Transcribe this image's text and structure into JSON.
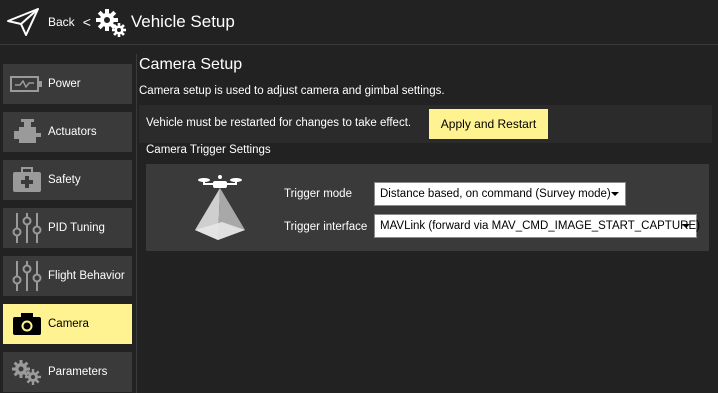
{
  "header": {
    "back_label": "Back",
    "separator": "<",
    "title": "Vehicle Setup",
    "back_icon": "paper-plane-icon",
    "title_icon": "gears-icon"
  },
  "sidebar": {
    "items": [
      {
        "label": "Power",
        "icon": "battery-icon",
        "active": false
      },
      {
        "label": "Actuators",
        "icon": "motor-icon",
        "active": false
      },
      {
        "label": "Safety",
        "icon": "first-aid-kit-icon",
        "active": false
      },
      {
        "label": "PID Tuning",
        "icon": "sliders-icon",
        "active": false
      },
      {
        "label": "Flight Behavior",
        "icon": "sliders-icon",
        "active": false
      },
      {
        "label": "Camera",
        "icon": "camera-icon",
        "active": true
      },
      {
        "label": "Parameters",
        "icon": "gears-icon",
        "active": false
      }
    ]
  },
  "main": {
    "title": "Camera Setup",
    "description": "Camera setup is used to adjust camera and gimbal settings.",
    "restart_notice": "Vehicle must be restarted for changes to take effect.",
    "apply_button": "Apply and Restart",
    "trigger_section": {
      "title": "Camera Trigger Settings",
      "icon": "drone-camera-trigger-icon",
      "trigger_mode_label": "Trigger mode",
      "trigger_mode_value": "Distance based, on command (Survey mode)",
      "trigger_interface_label": "Trigger interface",
      "trigger_interface_value": "MAVLink (forward via MAV_CMD_IMAGE_START_CAPTURE)"
    }
  },
  "colors": {
    "background": "#222222",
    "sidebar_item": "#3a3a3a",
    "accent": "#fff291",
    "panel": "#3a3a3a",
    "text": "#ffffff"
  }
}
